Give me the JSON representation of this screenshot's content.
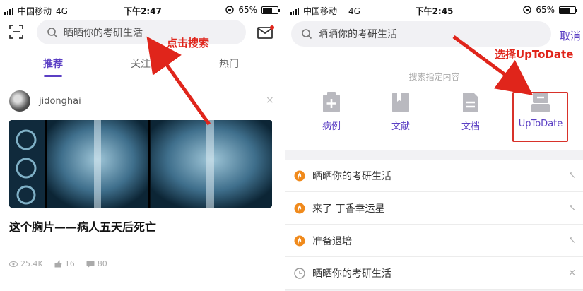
{
  "colors": {
    "accent": "#5b3fc4",
    "annotation": "#e0251b",
    "fire": "#f08a1c"
  },
  "left": {
    "status": {
      "carrier": "中国移动",
      "network": "4G",
      "time": "下午2:47",
      "battery": "65%",
      "battery_level": 0.65
    },
    "search": {
      "placeholder": "晒晒你的考研生活"
    },
    "tabs": [
      {
        "label": "推荐"
      },
      {
        "label": "关注"
      },
      {
        "label": "热门"
      }
    ],
    "post": {
      "author": "jidonghai",
      "close": "×",
      "title": "这个胸片——病人五天后死亡",
      "views": "25.4K",
      "likes": "16",
      "comments": "80"
    },
    "annotation": "点击搜索"
  },
  "right": {
    "status": {
      "carrier": "中国移动",
      "network": "4G",
      "time": "下午2:45",
      "battery": "65%",
      "battery_level": 0.65
    },
    "search": {
      "value": "晒晒你的考研生活"
    },
    "cancel": "取消",
    "scope_title": "搜索指定内容",
    "scopes": [
      {
        "label": "病例",
        "icon": "case-plus-icon"
      },
      {
        "label": "文献",
        "icon": "literature-book-icon"
      },
      {
        "label": "文档",
        "icon": "document-icon"
      },
      {
        "label": "UpToDate",
        "icon": "uptodate-tray-icon"
      }
    ],
    "annotation": "选择UpToDate",
    "history": [
      {
        "text": "晒晒你的考研生活",
        "icon": "hot-fire-icon",
        "action": "↖"
      },
      {
        "text": "来了 丁香幸运星",
        "icon": "hot-fire-icon",
        "action": "↖"
      },
      {
        "text": "准备退培",
        "icon": "hot-fire-icon",
        "action": "↖"
      },
      {
        "text": "晒晒你的考研生活",
        "icon": "history-clock-icon",
        "action": "×"
      }
    ]
  }
}
